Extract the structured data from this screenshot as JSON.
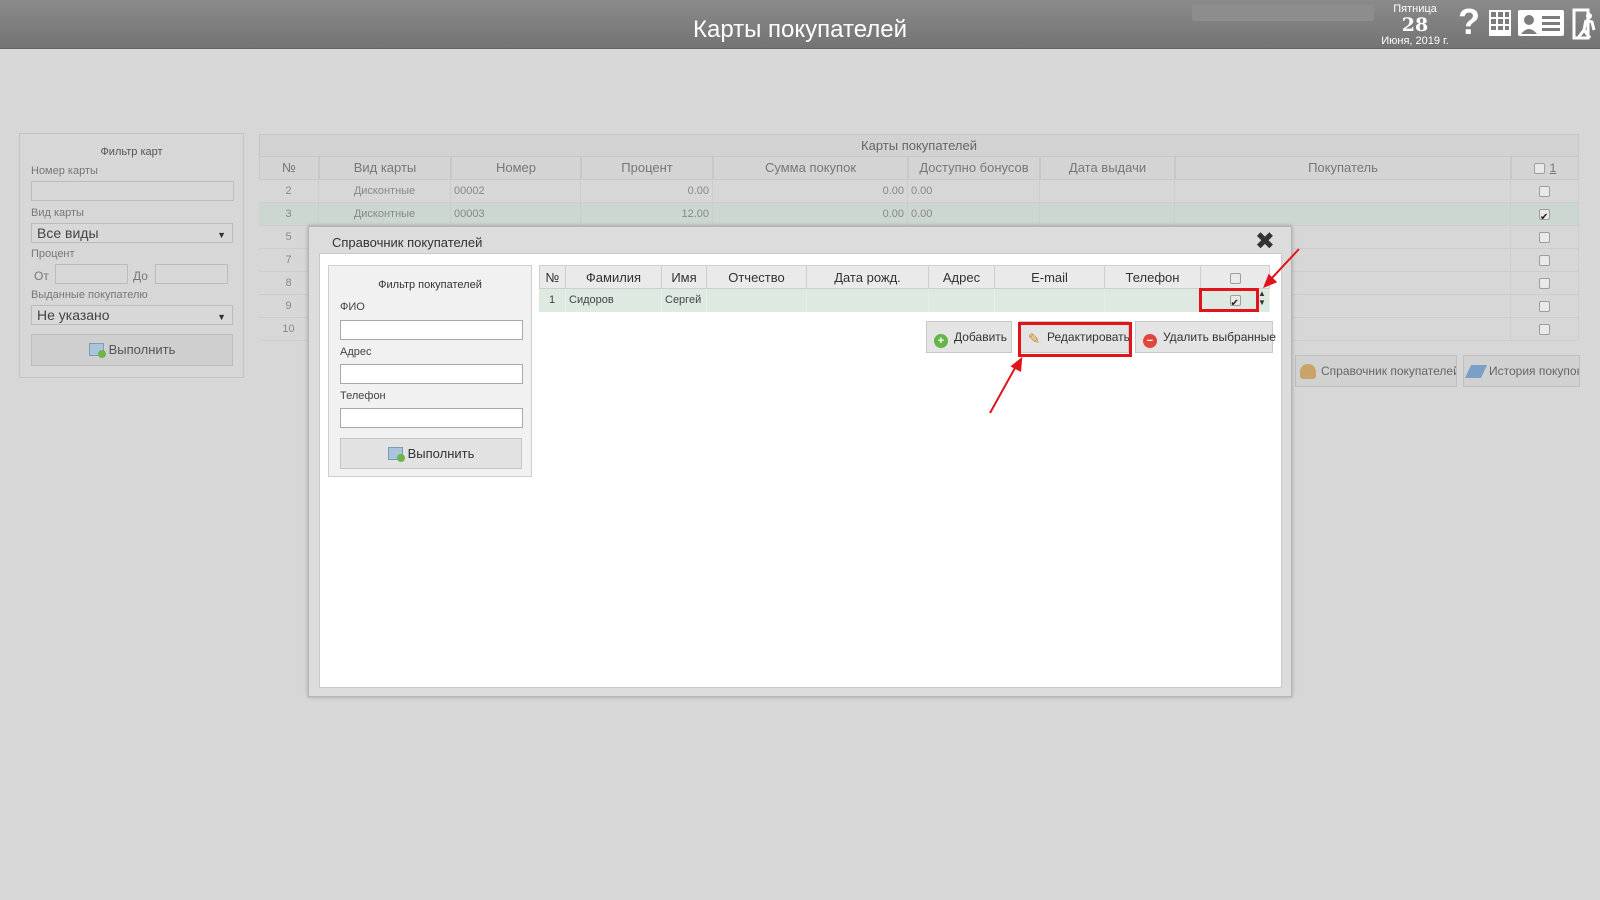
{
  "header": {
    "title": "Карты покупателей",
    "date": {
      "weekday": "Пятница",
      "day": "28",
      "month_year": "Июня, 2019 г."
    },
    "help_symbol": "?"
  },
  "filter": {
    "title": "Фильтр карт",
    "card_number_label": "Номер карты",
    "card_type_label": "Вид карты",
    "card_type_value": "Все виды",
    "percent_label": "Процент",
    "from_label": "От",
    "to_label": "До",
    "issued_label": "Выданные покупателю",
    "issued_value": "Не указано",
    "run_button": "Выполнить"
  },
  "cards_table": {
    "caption": "Карты покупателей",
    "columns": [
      "№",
      "Вид карты",
      "Номер",
      "Процент",
      "Сумма покупок",
      "Доступно бонусов",
      "Дата выдачи",
      "Покупатель"
    ],
    "page": "1",
    "rows": [
      {
        "n": "2",
        "type": "Дисконтные",
        "number": "00002",
        "percent": "0.00",
        "sum": "0.00",
        "bonus": "0.00"
      },
      {
        "n": "3",
        "type": "Дисконтные",
        "number": "00003",
        "percent": "12.00",
        "sum": "0.00",
        "bonus": "0.00"
      },
      {
        "n": "5"
      },
      {
        "n": "7"
      },
      {
        "n": "8"
      },
      {
        "n": "9"
      },
      {
        "n": "10"
      }
    ]
  },
  "side_buttons": {
    "directory": "Справочник покупателей",
    "history": "История покупок"
  },
  "dialog": {
    "title": "Справочник покупателей",
    "filter": {
      "title": "Фильтр покупателей",
      "fio_label": "ФИО",
      "address_label": "Адрес",
      "phone_label": "Телефон",
      "run_button": "Выполнить"
    },
    "columns": [
      "№",
      "Фамилия",
      "Имя",
      "Отчество",
      "Дата рожд.",
      "Адрес",
      "E-mail",
      "Телефон"
    ],
    "rows": [
      {
        "n": "1",
        "last_name": "Сидоров",
        "first_name": "Сергей",
        "checked": true
      }
    ],
    "buttons": {
      "add": "Добавить",
      "edit": "Редактировать",
      "delete": "Удалить выбранные"
    }
  },
  "colors": {
    "header_bg": "#7f7f7f",
    "annotation_red": "#e3131b",
    "selected_row": "#dde9e1"
  }
}
